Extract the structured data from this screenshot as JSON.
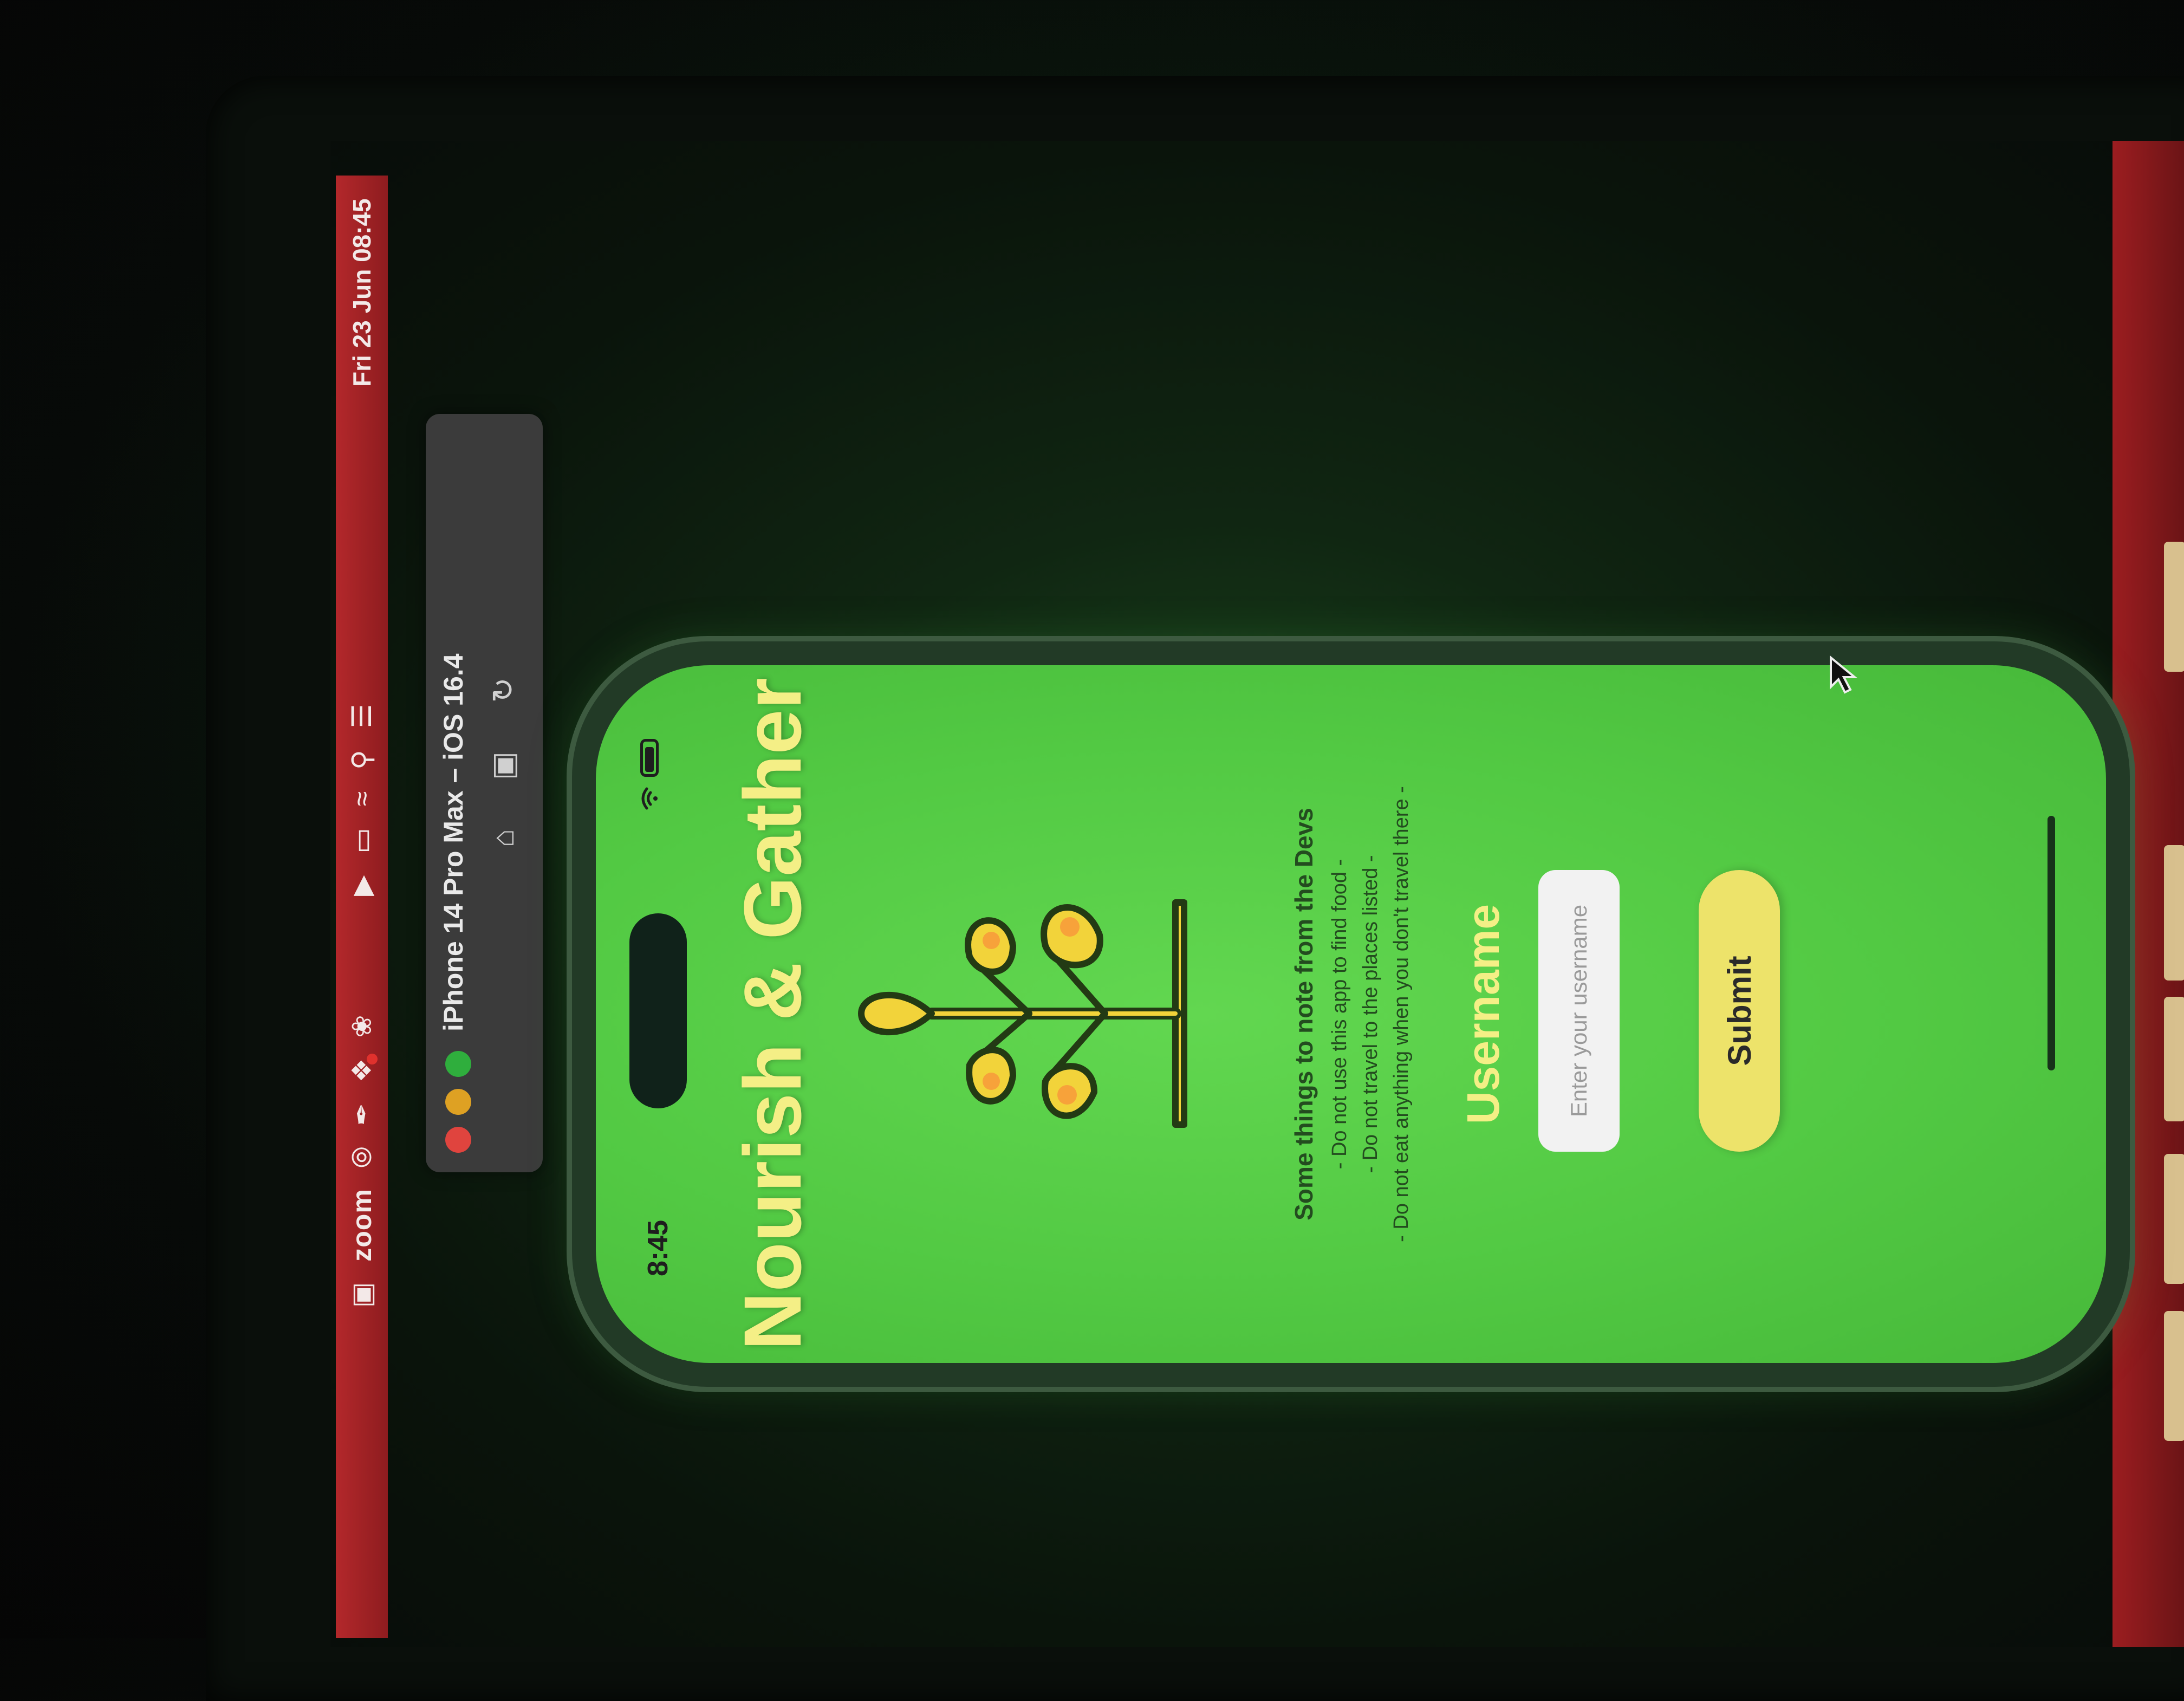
{
  "menubar": {
    "app_name": "zoom",
    "clock": "Fri 23 Jun 08:45",
    "icons": [
      "zoom-app-icon",
      "target-icon",
      "stylus-icon",
      "dropbox-icon",
      "squirrel-icon",
      "play-circle-icon",
      "battery-icon",
      "wifi-icon",
      "search-icon",
      "control-center-icon"
    ]
  },
  "simulator": {
    "title": "iPhone 14 Pro Max – iOS 16.4",
    "tools": [
      "home-icon",
      "screenshot-icon",
      "rotate-icon"
    ]
  },
  "phone": {
    "status_time": "8:45",
    "app_title": "Nourish & Gather",
    "notes": {
      "heading": "Some things to note from the Devs",
      "lines": [
        "- Do not use this app to find food -",
        "- Do not travel to the places listed -",
        "- Do not eat anything when you don't travel there -"
      ]
    },
    "username_label": "Username",
    "username_placeholder": "Enter your username",
    "submit_label": "Submit"
  },
  "colors": {
    "menubar": "#b3282b",
    "phone_bg": "#55cb45",
    "title_yellow": "#f4ef86",
    "submit_bg": "#ede36a"
  }
}
